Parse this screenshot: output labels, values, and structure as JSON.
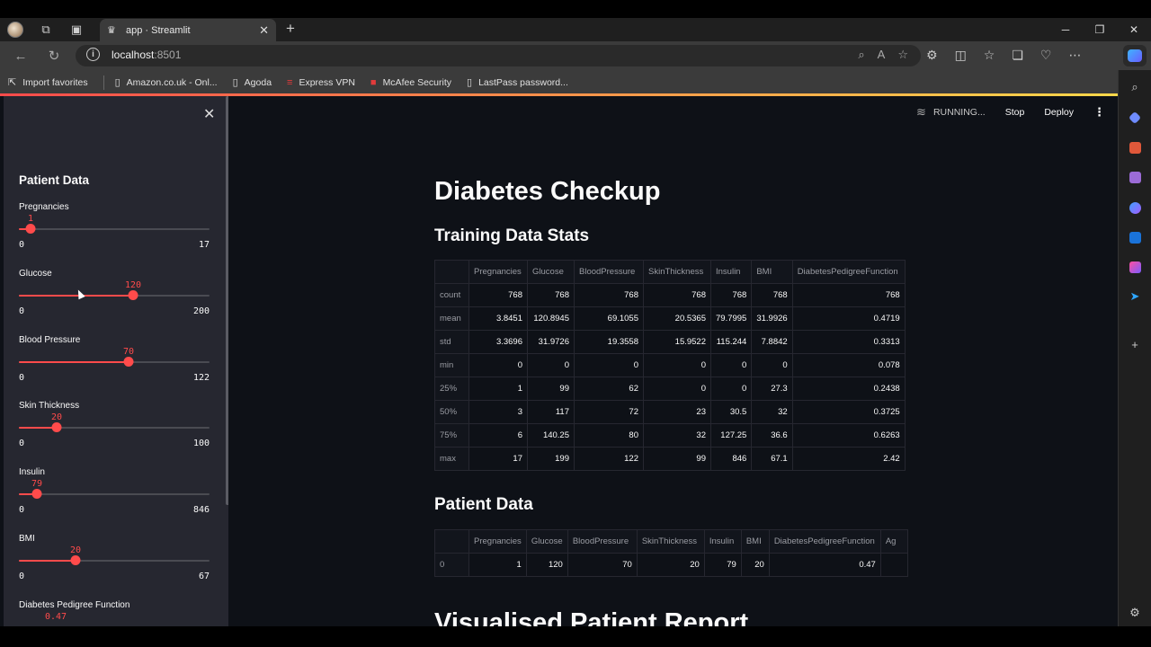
{
  "browser": {
    "tab_title": "app · Streamlit",
    "url_host": "localhost",
    "url_port": ":8501",
    "bookmarks": [
      "Import favorites",
      "Amazon.co.uk - Onl...",
      "Agoda",
      "Express VPN",
      "McAfee Security",
      "LastPass password..."
    ]
  },
  "header": {
    "status": "RUNNING...",
    "stop": "Stop",
    "deploy": "Deploy"
  },
  "sidebar": {
    "title": "Patient Data",
    "sliders": [
      {
        "label": "Pregnancies",
        "value": "1",
        "min": "0",
        "max": "17",
        "fraction": 0.059
      },
      {
        "label": "Glucose",
        "value": "120",
        "min": "0",
        "max": "200",
        "fraction": 0.6
      },
      {
        "label": "Blood Pressure",
        "value": "70",
        "min": "0",
        "max": "122",
        "fraction": 0.574
      },
      {
        "label": "Skin Thickness",
        "value": "20",
        "min": "0",
        "max": "100",
        "fraction": 0.2
      },
      {
        "label": "Insulin",
        "value": "79",
        "min": "0",
        "max": "846",
        "fraction": 0.093
      },
      {
        "label": "BMI",
        "value": "20",
        "min": "0",
        "max": "67",
        "fraction": 0.299
      },
      {
        "label": "Diabetes Pedigree Function",
        "value": "0.47"
      }
    ]
  },
  "main": {
    "title": "Diabetes Checkup",
    "stats_heading": "Training Data Stats",
    "stats_table": {
      "columns": [
        "",
        "Pregnancies",
        "Glucose",
        "BloodPressure",
        "SkinThickness",
        "Insulin",
        "BMI",
        "DiabetesPedigreeFunction"
      ],
      "rows": [
        [
          "count",
          "768",
          "768",
          "768",
          "768",
          "768",
          "768",
          "768"
        ],
        [
          "mean",
          "3.8451",
          "120.8945",
          "69.1055",
          "20.5365",
          "79.7995",
          "31.9926",
          "0.4719"
        ],
        [
          "std",
          "3.3696",
          "31.9726",
          "19.3558",
          "15.9522",
          "115.244",
          "7.8842",
          "0.3313"
        ],
        [
          "min",
          "0",
          "0",
          "0",
          "0",
          "0",
          "0",
          "0.078"
        ],
        [
          "25%",
          "1",
          "99",
          "62",
          "0",
          "0",
          "27.3",
          "0.2438"
        ],
        [
          "50%",
          "3",
          "117",
          "72",
          "23",
          "30.5",
          "32",
          "0.3725"
        ],
        [
          "75%",
          "6",
          "140.25",
          "80",
          "32",
          "127.25",
          "36.6",
          "0.6263"
        ],
        [
          "max",
          "17",
          "199",
          "122",
          "99",
          "846",
          "67.1",
          "2.42"
        ]
      ]
    },
    "patient_heading": "Patient Data",
    "patient_table": {
      "columns": [
        "",
        "Pregnancies",
        "Glucose",
        "BloodPressure",
        "SkinThickness",
        "Insulin",
        "BMI",
        "DiabetesPedigreeFunction",
        "Ag"
      ],
      "rows": [
        [
          "0",
          "1",
          "120",
          "70",
          "20",
          "79",
          "20",
          "0.47",
          ""
        ]
      ]
    },
    "report_heading": "Visualised Patient Report"
  }
}
